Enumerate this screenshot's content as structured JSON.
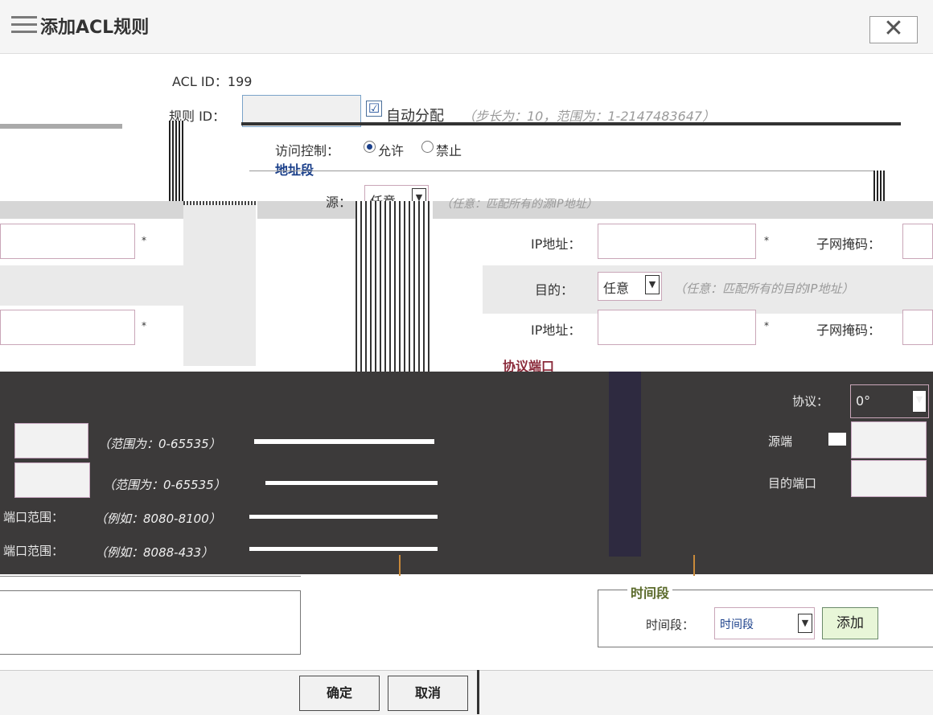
{
  "dialog": {
    "title": "添加ACL规则",
    "close_label": "✕"
  },
  "acl": {
    "id_label": "ACL ID：",
    "id_value": "199"
  },
  "rule": {
    "id_label": "规则 ID：",
    "id_value": "",
    "auto_label": "自动分配",
    "auto_checked": true,
    "hint": "（步长为：10，范围为：1-2147483647）"
  },
  "access": {
    "label": "访问控制：",
    "allow": "允许",
    "deny": "禁止",
    "selected": "allow"
  },
  "address": {
    "section_title": "地址段",
    "source_label": "源：",
    "source_value": "任意",
    "source_hint": "（任意：匹配所有的源IP地址）",
    "source_ip_label": "IP地址：",
    "source_mask_label": "子网掩码：",
    "dest_label": "目的：",
    "dest_value": "任意",
    "dest_hint": "（任意：匹配所有的目的IP地址）",
    "dest_ip_label": "IP地址：",
    "dest_mask_label": "子网掩码：",
    "required_mark": "*"
  },
  "protocol": {
    "section_title": "协议端口",
    "proto_label": "协议：",
    "proto_value": "0°",
    "src_port_label": "源端",
    "dst_port_label": "目的端口",
    "range_hint_1": "（范围为：0-65535）",
    "range_hint_2": "（范围为：0-65535）",
    "example_hint_1": "（例如：8080-8100）",
    "example_hint_2": "（例如：8088-433）",
    "port_range_label_1": "端口范围：",
    "port_range_label_2": "端口范围："
  },
  "time": {
    "section_title": "时间段",
    "label": "时间段：",
    "value": "时间段",
    "add_label": "添加"
  },
  "footer": {
    "ok_label": "确定",
    "cancel_label": "取消"
  },
  "colors": {
    "section_blue": "#1a3f8a",
    "dark_band": "#3c3a3a",
    "add_green": "#e8f6d8"
  }
}
